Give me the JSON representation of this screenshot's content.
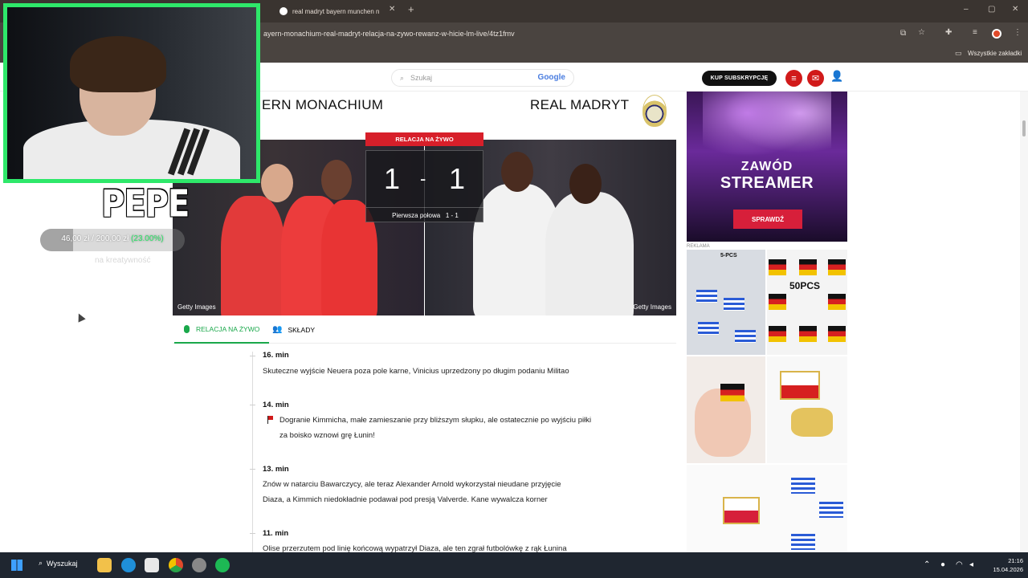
{
  "browser": {
    "tabs": [
      {
        "label": "real madryt bayern munchen n"
      }
    ],
    "url": "ayern-monachium-real-madryt-relacja-na-zywo-rewanz-w-hicie-lm-live/4tz1fmv",
    "bookmarks_label": "Wszystkie zakładki"
  },
  "site": {
    "search_placeholder": "Szukaj",
    "search_brand": "Google",
    "subscribe_label": "KUP SUBSKRYPCJĘ"
  },
  "match": {
    "home_team": "ERN MONACHIUM",
    "away_team": "REAL MADRYT",
    "live_label": "RELACJA NA ŻYWO",
    "home_score": "1",
    "separator": "-",
    "away_score": "1",
    "half_label": "Pierwsza połowa",
    "half_score": "1 - 1",
    "photo_credit_left": "Getty Images",
    "photo_credit_right": "Getty Images"
  },
  "subtabs": {
    "live": "RELACJA NA ŻYWO",
    "lineups": "SKŁADY"
  },
  "events": [
    {
      "minute": "16. min",
      "lines": [
        "Skuteczne wyjście Neuera poza pole karne, Vinicius uprzedzony po długim podaniu Militao"
      ]
    },
    {
      "minute": "14. min",
      "lines": [
        "Dogranie Kimmicha, małe zamieszanie przy bliższym słupku, ale ostatecznie po wyjściu piłki",
        "za boisko wznowi grę Łunin!"
      ]
    },
    {
      "minute": "13. min",
      "lines": [
        "Znów w natarciu Bawarczycy, ale teraz Alexander Arnold wykorzystał nieudane przyjęcie",
        "Diaza, a Kimmich niedokładnie podawał pod presją Valverde. Kane wywalcza korner"
      ]
    },
    {
      "minute": "11. min",
      "lines": [
        "Olise przerzutem pod linię końcową wypatrzył Diaza, ale ten zgrał futbolówkę z rąk Łunina"
      ]
    }
  ],
  "ads": {
    "ad1_line1": "ZAWÓD",
    "ad1_line2": "STREAMER",
    "ad1_button": "SPRAWDŹ",
    "reklama_label": "REKLAMA",
    "pcs_small": "5-PCS",
    "pcs_big": "50PCS"
  },
  "overlay": {
    "name": "PEPE",
    "donation_text": "46,00 zł / 200,00 zł",
    "donation_pct": "(23.00%)",
    "donation_progress": 0.23,
    "donation_sub": "na kreatywność"
  },
  "taskbar": {
    "search_label": "Wyszukaj",
    "time": "21:16",
    "date": "15.04.2026"
  },
  "colors": {
    "accent_green": "#1aa84b",
    "live_red": "#d71f2a",
    "cam_border": "#2ee86a"
  }
}
